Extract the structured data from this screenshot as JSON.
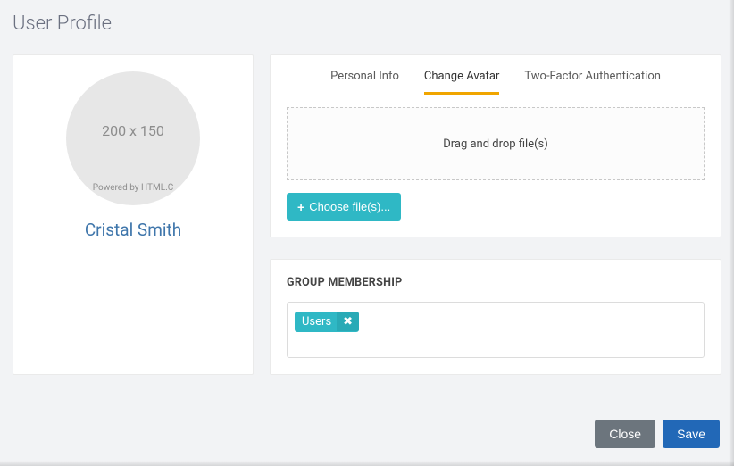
{
  "page_title": "User Profile",
  "avatar": {
    "placeholder_dim": "200 x 150",
    "powered": "Powered by HTML.C"
  },
  "user_name": "Cristal Smith",
  "tabs": {
    "personal": "Personal Info",
    "avatar": "Change Avatar",
    "twofa": "Two-Factor Authentication"
  },
  "dropzone_text": "Drag and drop file(s)",
  "choose_label": "Choose file(s)...",
  "group_header": "GROUP MEMBERSHIP",
  "group_tag": "Users",
  "buttons": {
    "close": "Close",
    "save": "Save"
  }
}
